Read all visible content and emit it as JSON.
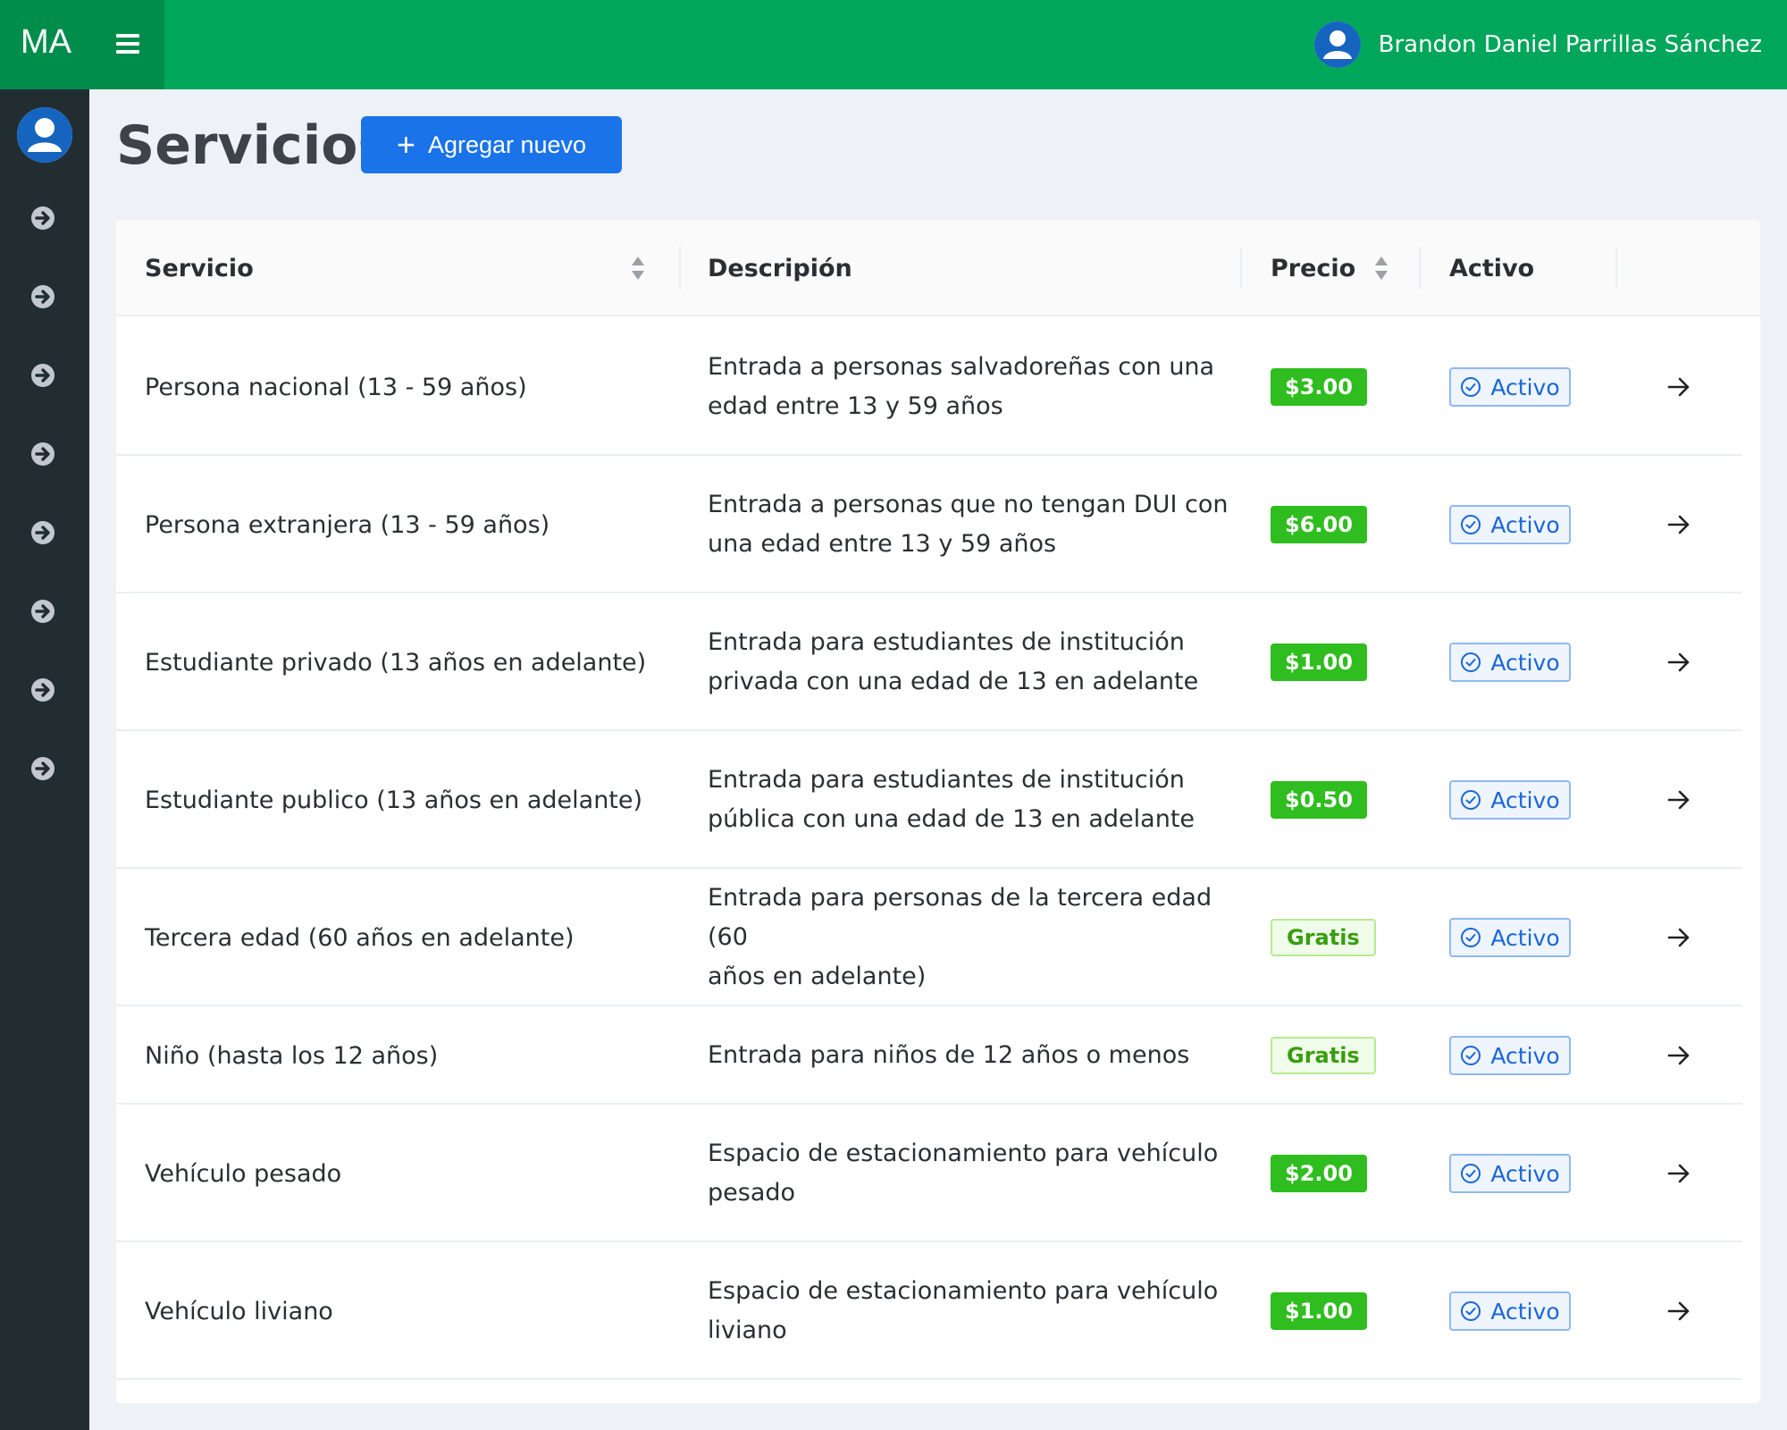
{
  "topbar": {
    "brand": "MA",
    "user_name": "Brandon Daniel Parrillas Sánchez"
  },
  "sidebar": {
    "items": [
      "arrow-circle-right-icon",
      "arrow-circle-right-icon",
      "arrow-circle-right-icon",
      "arrow-circle-right-icon",
      "arrow-circle-right-icon",
      "arrow-circle-right-icon",
      "arrow-circle-right-icon",
      "arrow-circle-right-icon"
    ]
  },
  "page": {
    "title": "Servicios",
    "add_button": "Agregar nuevo"
  },
  "table": {
    "headers": {
      "servicio": "Servicio",
      "descripcion": "Descripión",
      "precio": "Precio",
      "activo": "Activo"
    },
    "rows": [
      {
        "servicio": "Persona nacional (13 - 59 años)",
        "desc1": "Entrada a personas salvadoreñas con una",
        "desc2": "edad entre 13 y 59 años",
        "precio": "$3.00",
        "gratis": false,
        "activo": "Activo"
      },
      {
        "servicio": "Persona extranjera (13 - 59 años)",
        "desc1": "Entrada a personas que no tengan DUI con",
        "desc2": "una edad entre 13 y 59 años",
        "precio": "$6.00",
        "gratis": false,
        "activo": "Activo"
      },
      {
        "servicio": "Estudiante privado (13 años en adelante)",
        "desc1": "Entrada para estudiantes de institución",
        "desc2": "privada con una edad de 13 en adelante",
        "precio": "$1.00",
        "gratis": false,
        "activo": "Activo"
      },
      {
        "servicio": "Estudiante publico (13 años en adelante)",
        "desc1": "Entrada para estudiantes de institución",
        "desc2": "pública con una edad de 13 en adelante",
        "precio": "$0.50",
        "gratis": false,
        "activo": "Activo"
      },
      {
        "servicio": "Tercera edad (60 años en adelante)",
        "desc1": "Entrada para personas de la tercera edad (60",
        "desc2": "años en adelante)",
        "precio": "Gratis",
        "gratis": true,
        "activo": "Activo"
      },
      {
        "servicio": "Niño (hasta los 12 años)",
        "desc1": "Entrada para niños de 12 años o menos",
        "desc2": "",
        "precio": "Gratis",
        "gratis": true,
        "activo": "Activo"
      },
      {
        "servicio": "Vehículo pesado",
        "desc1": "Espacio de estacionamiento para vehículo",
        "desc2": "pesado",
        "precio": "$2.00",
        "gratis": false,
        "activo": "Activo"
      },
      {
        "servicio": "Vehículo liviano",
        "desc1": "Espacio de estacionamiento para vehículo",
        "desc2": "liviano",
        "precio": "$1.00",
        "gratis": false,
        "activo": "Activo"
      }
    ]
  },
  "colors": {
    "topbar": "#00a65a",
    "brand_bg": "#008d4c",
    "sidebar": "#222d32",
    "primary": "#1a73e8",
    "price_badge": "#2fbd1f"
  }
}
